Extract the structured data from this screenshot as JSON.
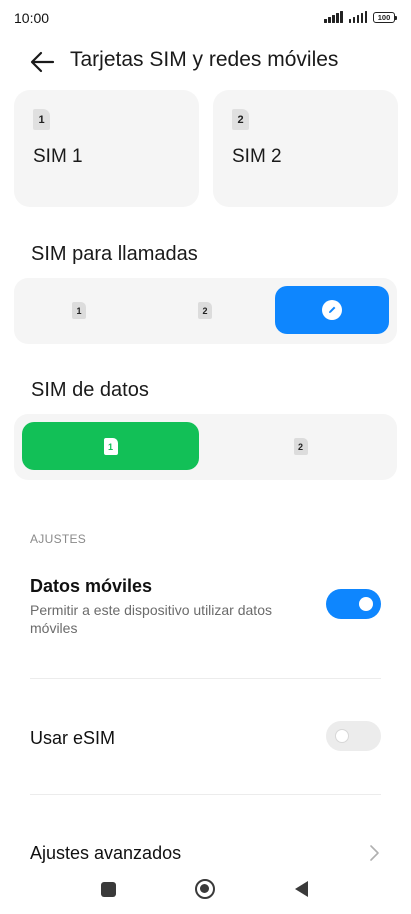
{
  "status_bar": {
    "time": "10:00",
    "battery": "100"
  },
  "header": {
    "title": "Tarjetas SIM y redes móviles",
    "back_icon": "arrow-left-icon"
  },
  "sim_cards": [
    {
      "badge": "1",
      "label": "SIM 1"
    },
    {
      "badge": "2",
      "label": "SIM 2"
    }
  ],
  "calls": {
    "title": "SIM para llamadas",
    "options": [
      "1",
      "2"
    ],
    "selected_icon": "edit-pencil-icon"
  },
  "data_sim": {
    "title": "SIM de datos",
    "options": [
      "1",
      "2"
    ],
    "selected": "1"
  },
  "settings": {
    "caption": "AJUSTES",
    "mobile_data": {
      "title": "Datos móviles",
      "subtitle": "Permitir a este dispositivo utilizar datos móviles",
      "enabled": true
    },
    "esim": {
      "title": "Usar eSIM",
      "enabled": false
    },
    "advanced": {
      "title": "Ajustes avanzados",
      "icon": "chevron-right-icon"
    }
  },
  "colors": {
    "accent_blue": "#0e86fe",
    "accent_green": "#12c057",
    "card_bg": "#f5f5f5"
  },
  "nav_bar": {
    "icons": [
      "recents-square-icon",
      "home-circle-icon",
      "back-triangle-icon"
    ]
  }
}
